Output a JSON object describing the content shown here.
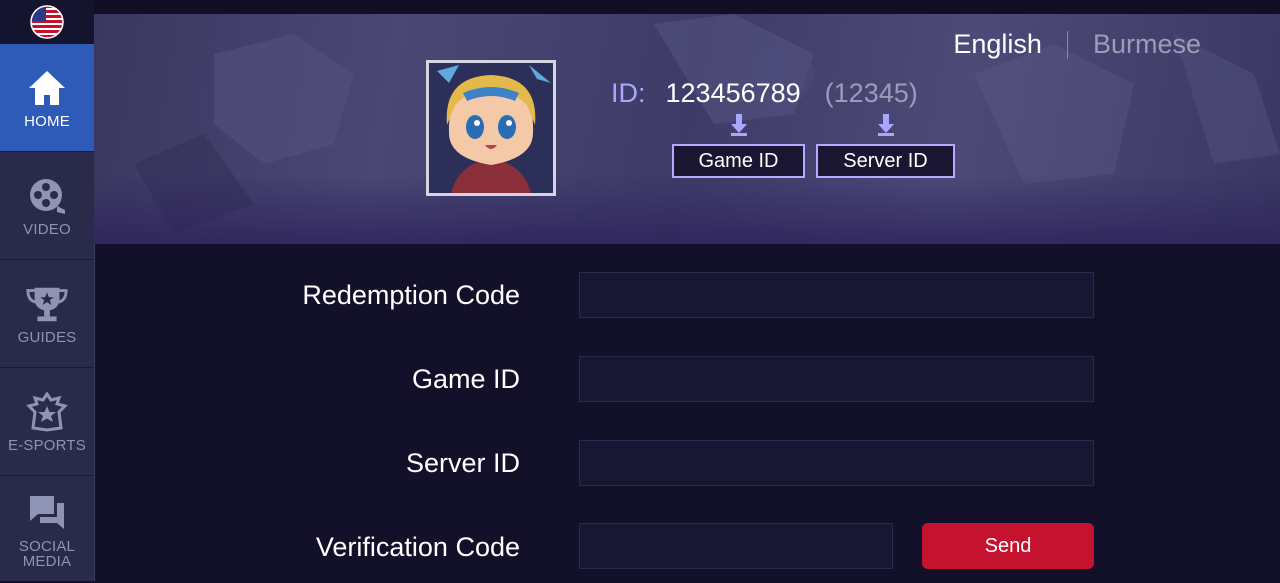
{
  "sidebar": {
    "flag_icon": "us-flag-icon",
    "items": [
      {
        "label": "HOME",
        "icon": "home-icon",
        "active": true
      },
      {
        "label": "VIDEO",
        "icon": "film-reel-icon",
        "active": false
      },
      {
        "label": "GUIDES",
        "icon": "trophy-icon",
        "active": false
      },
      {
        "label": "E-SPORTS",
        "icon": "esports-crest-icon",
        "active": false
      },
      {
        "label": "SOCIAL\nMEDIA",
        "icon": "chat-bubbles-icon",
        "active": false
      }
    ]
  },
  "header": {
    "languages": {
      "english": "English",
      "burmese": "Burmese",
      "selected": "English"
    },
    "id_label": "ID:",
    "game_id_value": "123456789",
    "server_id_value": "(12345)",
    "game_id_tag": "Game ID",
    "server_id_tag": "Server ID"
  },
  "form": {
    "redemption_code_label": "Redemption Code",
    "game_id_label": "Game ID",
    "server_id_label": "Server ID",
    "verification_code_label": "Verification Code",
    "send_label": "Send",
    "redemption_code_value": "",
    "game_id_value": "",
    "server_id_value": "",
    "verification_code_value": ""
  },
  "colors": {
    "accent_blue": "#2e5bb8",
    "send_red": "#c4122f",
    "id_purple": "#a9a6ff"
  }
}
